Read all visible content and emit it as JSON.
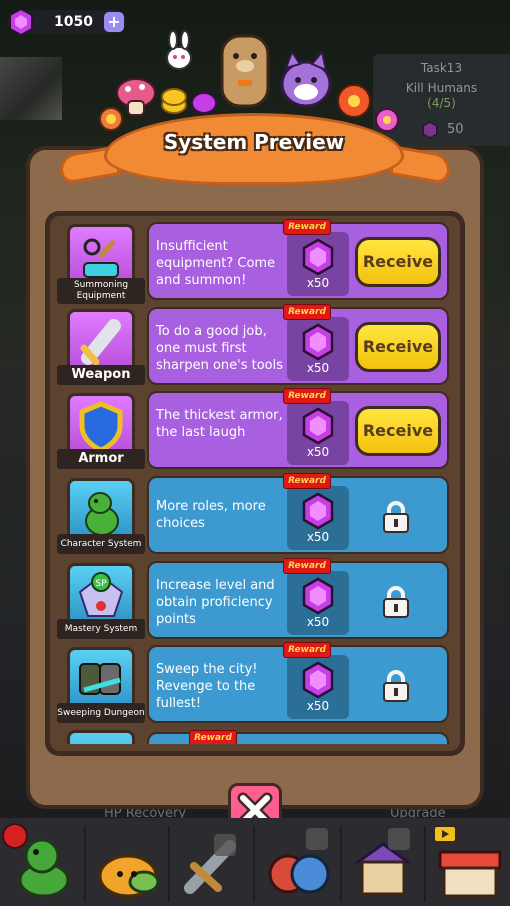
{
  "currency": {
    "gems": "1050",
    "plus_icon": "plus-icon"
  },
  "task": {
    "title": "Task13",
    "name": "Kill Humans",
    "progress": "(4/5)",
    "reward": "50"
  },
  "modal": {
    "title": "System Preview",
    "close_icon": "close-icon",
    "reward_tag": "Reward",
    "rows": [
      {
        "label": "Summoning Equipment",
        "desc": "Insufficient equipment? Come and summon!",
        "qty": "x50",
        "action": "Receive",
        "icon": "summon-icon"
      },
      {
        "label": "Weapon",
        "desc": "To do a good job, one must first sharpen one's tools",
        "qty": "x50",
        "action": "Receive",
        "icon": "sword-icon"
      },
      {
        "label": "Armor",
        "desc": "The thickest armor, the last laugh",
        "qty": "x50",
        "action": "Receive",
        "icon": "shield-icon"
      },
      {
        "label": "Character System",
        "desc": "More roles, more choices",
        "qty": "x50",
        "action": "",
        "icon": "dinosaur-icon"
      },
      {
        "label": "Mastery System",
        "desc": "Increase level and obtain proficiency points",
        "qty": "x50",
        "action": "",
        "icon": "mastery-icon"
      },
      {
        "label": "Sweeping Dungeon",
        "desc": "Sweep the city! Revenge to the fullest!",
        "qty": "x50",
        "action": "",
        "icon": "dungeon-icon"
      }
    ]
  },
  "background_text": {
    "left": "HP Recovery",
    "right": "Upgrade"
  },
  "bottom_nav": [
    "dinosaur-icon",
    "slime-icon",
    "sword-icon",
    "heroes-icon",
    "shop-icon",
    "store-icon"
  ]
}
